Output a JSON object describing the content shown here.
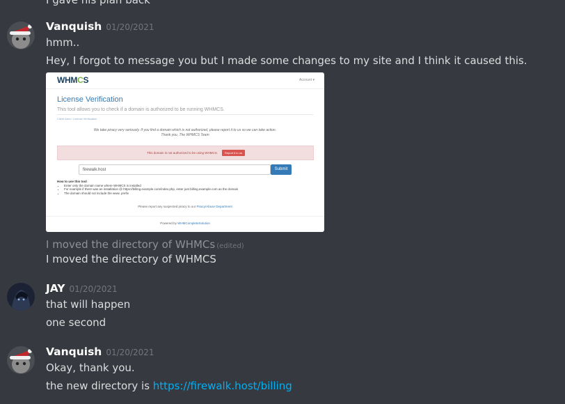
{
  "clipped_top_text": "I gave his plan back",
  "messages": [
    {
      "author": "Vanquish",
      "timestamp": "01/20/2021",
      "lines": [
        "hmm..",
        "Hey, I forgot to message you but I made some changes to my site and I think it caused this."
      ]
    },
    {
      "edited_line": "I moved the directory of WHMCs",
      "edited_tag": "(edited)",
      "line": "I moved the directory of WHMCS"
    },
    {
      "author": "JAY",
      "timestamp": "01/20/2021",
      "lines": [
        "that will happen",
        "one second"
      ]
    },
    {
      "author": "Vanquish",
      "timestamp": "01/20/2021",
      "lines": [
        "Okay, thank you."
      ],
      "link_prefix": "the new directory is ",
      "link_text": "https://firewalk.host/billing"
    }
  ],
  "attachment": {
    "logo_main": "WHM",
    "logo_c": "C",
    "logo_end": "S",
    "account": "Account ▾",
    "title": "License Verification",
    "subtitle": "This tool allows you to check if a domain is authorized to be running WHMCS.",
    "breadcrumb": "Client Area  /  License Verification",
    "notice_1": "We take piracy very seriously. If you find a domain which is not authorized, please report it to us so we can take action.",
    "notice_2": "Thank you, The WHMCS Team",
    "alert_text": "This domain is not authorized to be using WHMCS.",
    "alert_button": "Report it to us",
    "domain_value": "firewalk.host",
    "submit_label": "Submit",
    "howto_title": "How to use this tool",
    "howto_items": [
      "Enter only the domain name where WHMCS is installed",
      "For example if there was an installation @ https://billing.example.com/index.php, enter just billing.example.com as the domain",
      "The domain should not include the www. prefix"
    ],
    "footer_report_prefix": "Please report any suspected piracy to our",
    "footer_report_link": "Piracy/Abuse Department",
    "footer_powered_prefix": "Powered by",
    "footer_powered_link": "WHMCompleteSolution"
  },
  "colors": {
    "background": "#36393f",
    "author": "#ffffff",
    "timestamp": "#72767d",
    "text": "#dcddde",
    "link": "#00b0f4"
  }
}
